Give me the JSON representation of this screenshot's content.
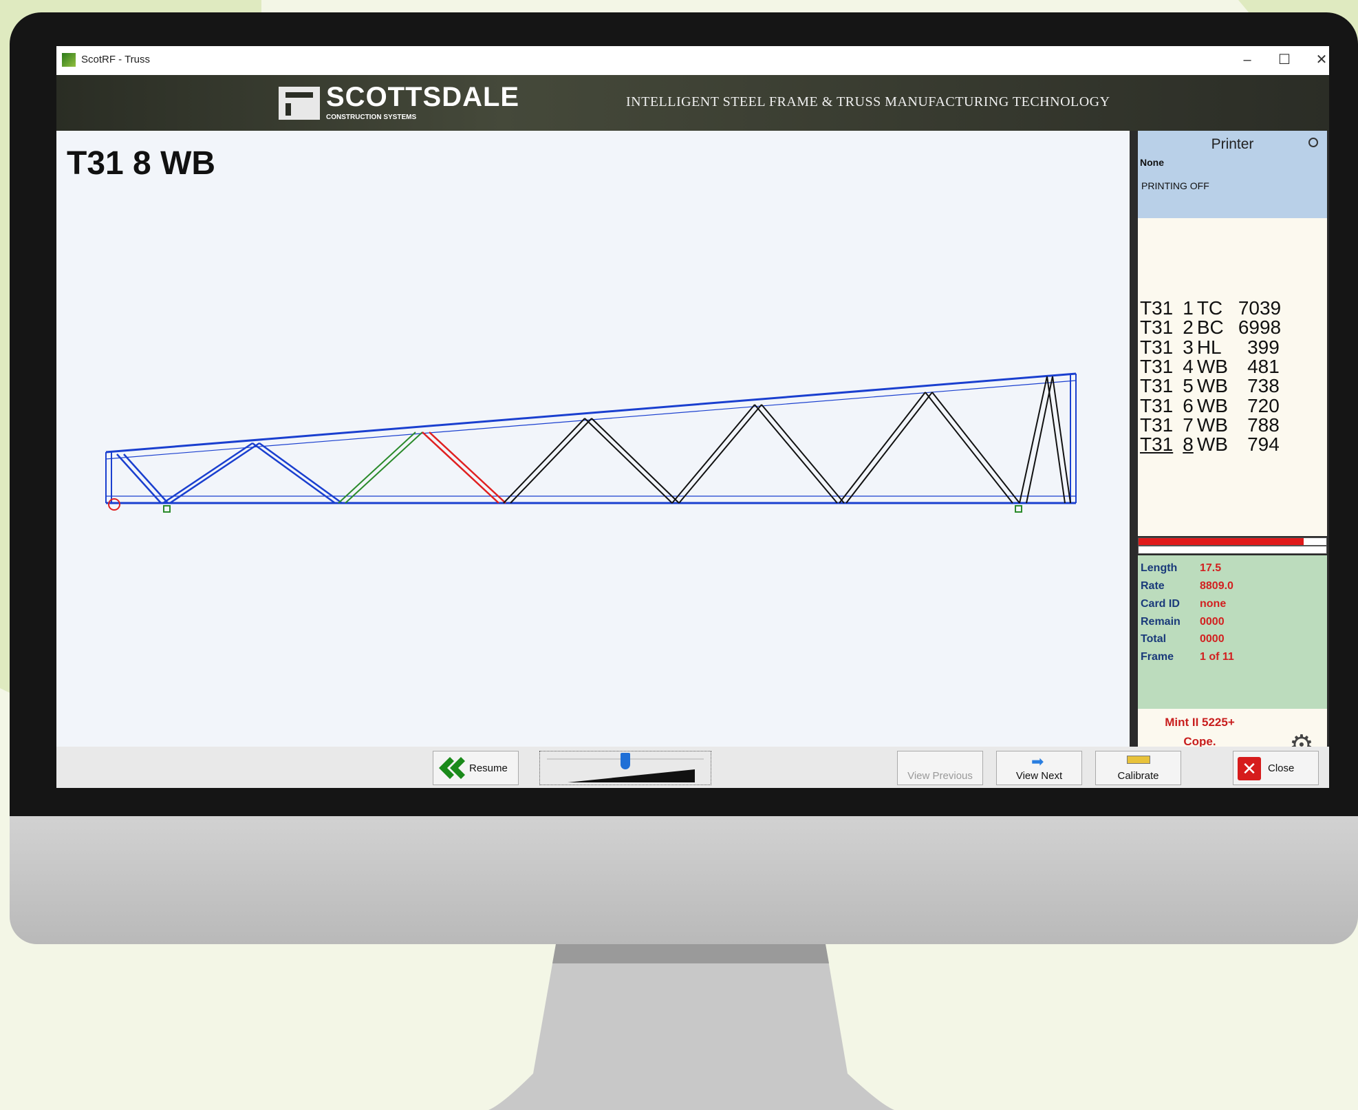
{
  "window": {
    "title": "ScotRF - Truss",
    "minimize": "–",
    "maximize": "☐",
    "close": "✕"
  },
  "banner": {
    "brand": "SCOTTSDALE",
    "brand_sub": "CONSTRUCTION SYSTEMS",
    "tagline": "INTELLIGENT STEEL FRAME & TRUSS MANUFACTURING TECHNOLOGY"
  },
  "frame_title": "T31 8 WB",
  "printer": {
    "heading": "Printer",
    "name": "None",
    "status": "PRINTING OFF"
  },
  "parts": [
    {
      "frame": "T31",
      "num": "1",
      "type": "TC",
      "length": "7039"
    },
    {
      "frame": "T31",
      "num": "2",
      "type": "BC",
      "length": "6998"
    },
    {
      "frame": "T31",
      "num": "3",
      "type": "HL",
      "length": "399"
    },
    {
      "frame": "T31",
      "num": "4",
      "type": "WB",
      "length": "481"
    },
    {
      "frame": "T31",
      "num": "5",
      "type": "WB",
      "length": "738"
    },
    {
      "frame": "T31",
      "num": "6",
      "type": "WB",
      "length": "720"
    },
    {
      "frame": "T31",
      "num": "7",
      "type": "WB",
      "length": "788"
    },
    {
      "frame": "T31",
      "num": "8",
      "type": "WB",
      "length": "794"
    }
  ],
  "progress": 0.88,
  "stats": {
    "length_label": "Length",
    "length": "17.5",
    "rate_label": "Rate",
    "rate": "8809.0",
    "card_label": "Card ID",
    "card": "none",
    "remain_label": "Remain",
    "remain": "0000",
    "total_label": "Total",
    "total": "0000",
    "frame_label": "Frame",
    "frame": "1 of 11"
  },
  "machine": {
    "model": "Mint II 5225+",
    "mode": "Cope."
  },
  "toolbar": {
    "resume": "Resume",
    "view_previous": "View Previous",
    "view_next": "View Next",
    "calibrate": "Calibrate",
    "close": "Close",
    "speed": 0.5
  },
  "icons": [
    "app-icon",
    "resume-icon",
    "view-next-icon",
    "calibrate-icon",
    "close-icon",
    "gear-icon",
    "refresh-icon"
  ],
  "colors": {
    "active_member": "#e02020",
    "done_member": "#2a8a2a",
    "chord": "#1a3fcf",
    "banner": "#3a3d31"
  }
}
